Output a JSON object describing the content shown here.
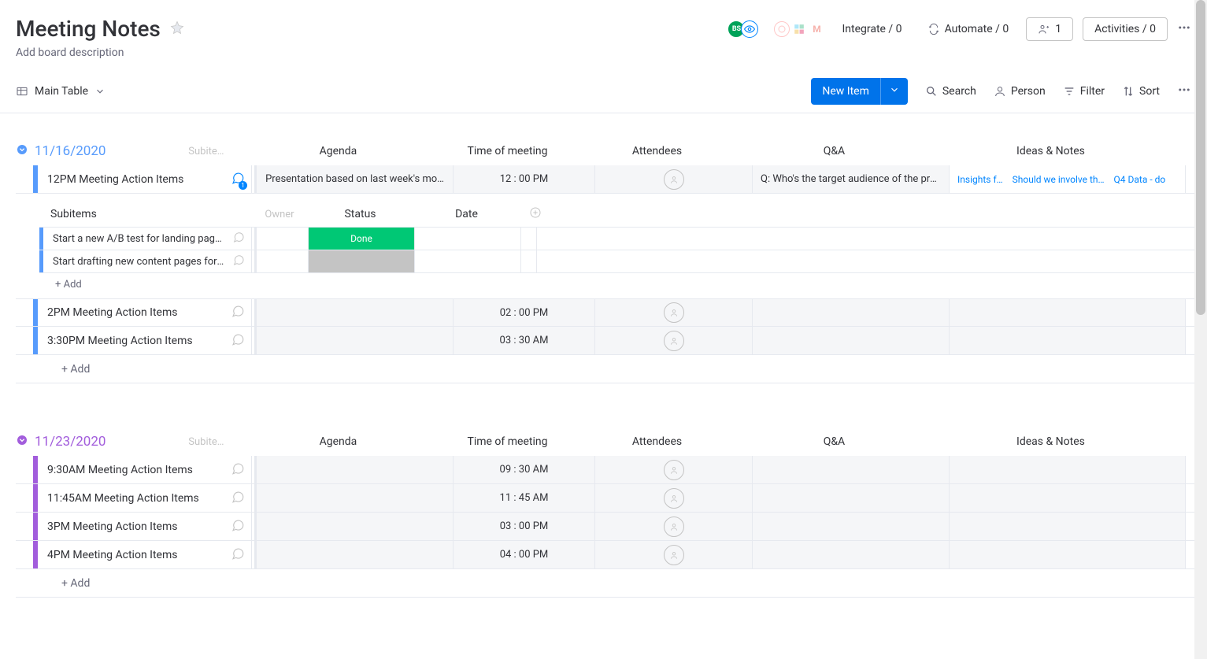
{
  "header": {
    "title": "Meeting Notes",
    "description": "Add board description",
    "integrate": "Integrate / 0",
    "automate": "Automate / 0",
    "members": "1",
    "activities": "Activities / 0",
    "avatar_bs": "BS"
  },
  "toolbar": {
    "view_label": "Main Table",
    "new_item": "New Item",
    "search": "Search",
    "person": "Person",
    "filter": "Filter",
    "sort": "Sort"
  },
  "columns": {
    "subitems_hint": "Subite…",
    "agenda": "Agenda",
    "time": "Time of meeting",
    "attendees": "Attendees",
    "qa": "Q&A",
    "ideas": "Ideas & Notes"
  },
  "sub_columns": {
    "name": "Subitems",
    "owner": "Owner",
    "status": "Status",
    "date": "Date"
  },
  "add_label": "+ Add",
  "groups": [
    {
      "title": "11/16/2020",
      "color_class": "blue",
      "rows": [
        {
          "name": "12PM Meeting Action Items",
          "chat_active": true,
          "chat_count": "1",
          "agenda": "Presentation based on last week's mo…",
          "time": "12 : 00 PM",
          "qa": "Q: Who's the target audience of the pres…",
          "ideas": [
            "Insights f…",
            "Should we involve th…",
            "Q4 Data - do"
          ],
          "subitems": [
            {
              "name": "Start a new A/B test for landing page b…",
              "status": "Done",
              "status_class": "status-done"
            },
            {
              "name": "Start drafting new content pages for cli…",
              "status": "",
              "status_class": "status-empty"
            }
          ]
        },
        {
          "name": "2PM Meeting Action Items",
          "time": "02 : 00 PM"
        },
        {
          "name": "3:30PM Meeting Action Items",
          "time": "03 : 30 AM"
        }
      ]
    },
    {
      "title": "11/23/2020",
      "color_class": "purple",
      "rows": [
        {
          "name": "9:30AM Meeting Action Items",
          "time": "09 : 30 AM"
        },
        {
          "name": "11:45AM Meeting Action Items",
          "time": "11 : 45 AM"
        },
        {
          "name": "3PM Meeting Action Items",
          "time": "03 : 00 PM"
        },
        {
          "name": "4PM Meeting Action Items",
          "time": "04 : 00 PM"
        }
      ]
    }
  ]
}
